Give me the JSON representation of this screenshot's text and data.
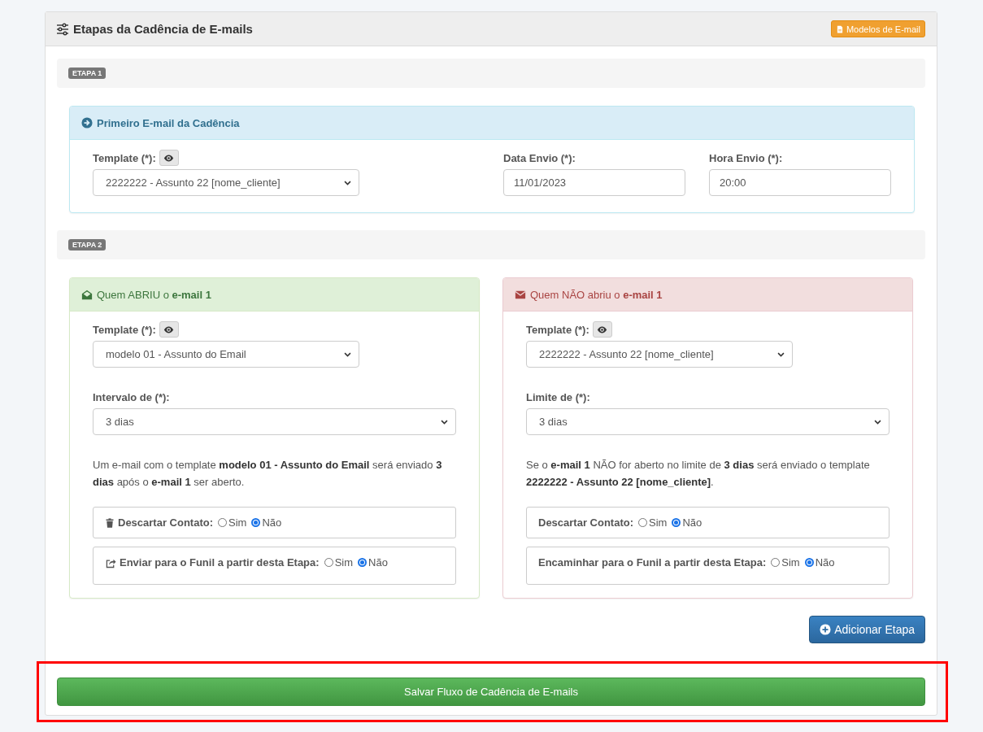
{
  "panel": {
    "title": "Etapas da Cadência de E-mails",
    "templates_button": "Modelos de E-mail"
  },
  "stages": [
    {
      "badge": "ETAPA 1",
      "cards": [
        {
          "kind": "info",
          "title": "Primeiro E-mail da Cadência",
          "fields": [
            {
              "kind": "template",
              "label": "Template (*):",
              "value": "2222222 - Assunto 22 [nome_cliente]"
            },
            {
              "kind": "input",
              "label": "Data Envio (*):",
              "value": "11/01/2023"
            },
            {
              "kind": "input",
              "label": "Hora Envio (*):",
              "value": "20:00"
            }
          ]
        }
      ]
    },
    {
      "badge": "ETAPA 2",
      "cards": [
        {
          "kind": "success",
          "option_icons": true,
          "title": "Quem ABRIU o **e-mail 1**",
          "fields": [
            {
              "kind": "template",
              "label": "Template (*):",
              "value": "modelo 01 - Assunto do Email"
            },
            {
              "kind": "select",
              "label": "Intervalo de (*):",
              "value": "3 dias"
            }
          ],
          "note": "Um e-mail com o template **modelo 01 - Assunto do Email** será enviado **3 dias** após o **e-mail 1** ser aberto.",
          "options": [
            {
              "label": "Descartar Contato:",
              "choices": [
                {
                  "label": "Sim",
                  "selected": false
                },
                {
                  "label": "Não",
                  "selected": true
                }
              ]
            },
            {
              "label": "Enviar para o Funil a partir desta Etapa:",
              "choices": [
                {
                  "label": "Sim",
                  "selected": false
                },
                {
                  "label": "Não",
                  "selected": true
                }
              ]
            }
          ]
        },
        {
          "kind": "danger",
          "option_icons": false,
          "title": "Quem NÃO abriu o **e-mail 1**",
          "fields": [
            {
              "kind": "template",
              "label": "Template (*):",
              "value": "2222222 - Assunto 22 [nome_cliente]"
            },
            {
              "kind": "select",
              "label": "Limite de (*):",
              "value": "3 dias"
            }
          ],
          "note": "Se o **e-mail 1** NÃO for aberto no limite de **3 dias** será enviado o template **2222222 - Assunto 22 [nome_cliente]**.",
          "options": [
            {
              "label": "Descartar Contato:",
              "choices": [
                {
                  "label": "Sim",
                  "selected": false
                },
                {
                  "label": "Não",
                  "selected": true
                }
              ]
            },
            {
              "label": "Encaminhar para o Funil a partir desta Etapa:",
              "choices": [
                {
                  "label": "Sim",
                  "selected": false
                },
                {
                  "label": "Não",
                  "selected": true
                }
              ]
            }
          ]
        }
      ]
    }
  ],
  "add_button": "Adicionar Etapa",
  "save_button": "Salvar Fluxo de Cadência de E-mails"
}
